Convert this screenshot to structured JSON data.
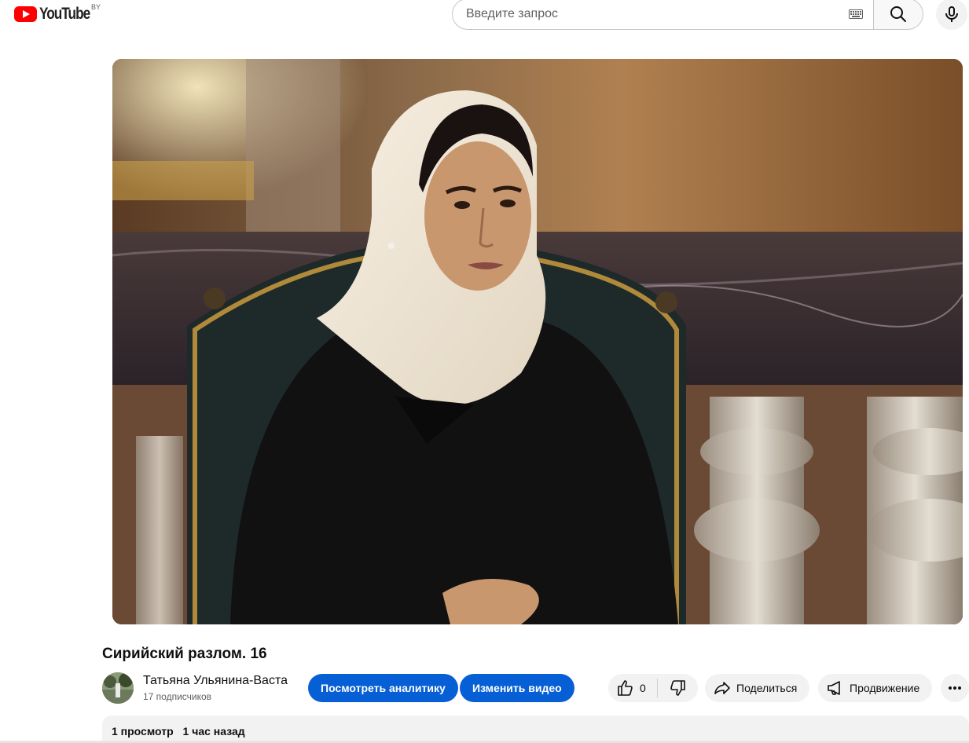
{
  "header": {
    "logo_text": "YouTube",
    "country_code": "BY",
    "search_placeholder": "Введите запрос",
    "search_value": ""
  },
  "player": {
    "thumbnail_description": ""
  },
  "video": {
    "title": "Сирийский разлом. 16"
  },
  "channel": {
    "name": "Татьяна Ульянина-Васта",
    "subscribers": "17 подписчиков"
  },
  "actions": {
    "analytics_label": "Посмотреть аналитику",
    "edit_label": "Изменить видео",
    "like_count": "0",
    "share_label": "Поделиться",
    "promote_label": "Продвижение"
  },
  "description": {
    "views": "1 просмотр",
    "published": "1 час назад"
  },
  "colors": {
    "brand_red": "#ff0000",
    "primary_blue": "#065fd4",
    "chip_grey": "#f2f2f2"
  },
  "icons": [
    "youtube-logo-icon",
    "keyboard-icon",
    "search-icon",
    "mic-icon",
    "thumbs-up-icon",
    "thumbs-down-icon",
    "share-icon",
    "megaphone-icon",
    "more-horizontal-icon"
  ]
}
